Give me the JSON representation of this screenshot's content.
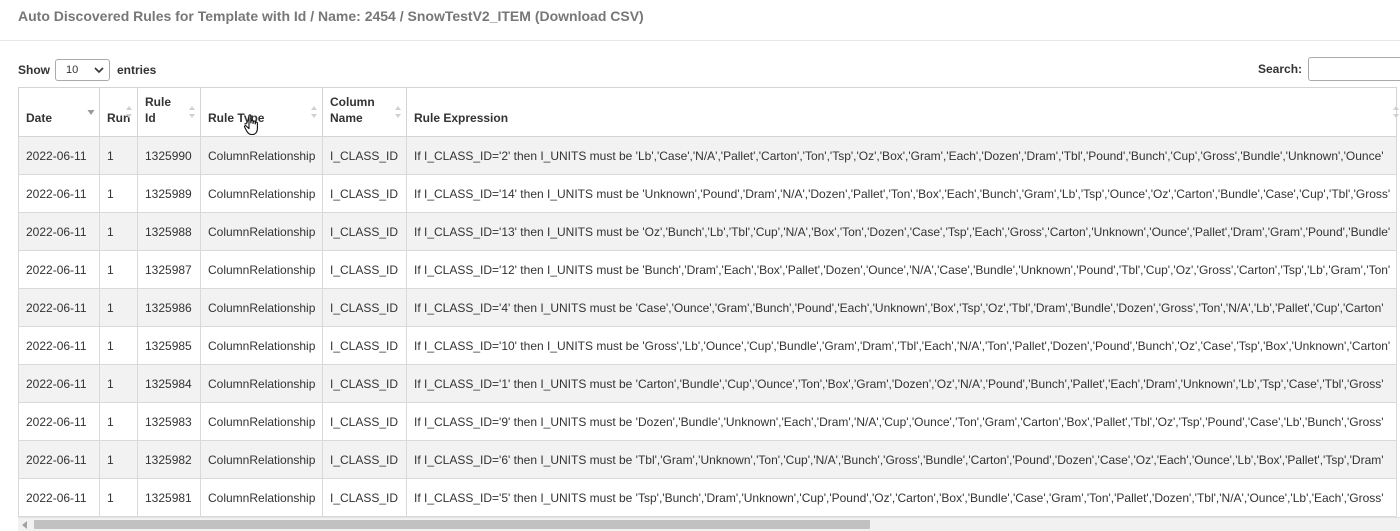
{
  "header": {
    "title": "Auto Discovered Rules for Template with Id / Name: 2454 / SnowTestV2_ITEM (Download CSV)"
  },
  "length_control": {
    "prefix": "Show",
    "selected": "10",
    "suffix": "entries"
  },
  "search": {
    "label": "Search:",
    "value": "",
    "placeholder": ""
  },
  "table": {
    "columns": [
      "Date",
      "Run",
      "Rule Id",
      "Rule Type",
      "Column Name",
      "Rule Expression"
    ],
    "sorted_column": "Date",
    "sort_direction": "descending",
    "rows": [
      [
        "2022-06-11",
        "1",
        "1325990",
        "ColumnRelationship",
        "I_CLASS_ID",
        "If I_CLASS_ID='2' then I_UNITS must be 'Lb','Case','N/A','Pallet','Carton','Ton','Tsp','Oz','Box','Gram','Each','Dozen','Dram','Tbl','Pound','Bunch','Cup','Gross','Bundle','Unknown','Ounce'"
      ],
      [
        "2022-06-11",
        "1",
        "1325989",
        "ColumnRelationship",
        "I_CLASS_ID",
        "If I_CLASS_ID='14' then I_UNITS must be 'Unknown','Pound','Dram','N/A','Dozen','Pallet','Ton','Box','Each','Bunch','Gram','Lb','Tsp','Ounce','Oz','Carton','Bundle','Case','Cup','Tbl','Gross'"
      ],
      [
        "2022-06-11",
        "1",
        "1325988",
        "ColumnRelationship",
        "I_CLASS_ID",
        "If I_CLASS_ID='13' then I_UNITS must be 'Oz','Bunch','Lb','Tbl','Cup','N/A','Box','Ton','Dozen','Case','Tsp','Each','Gross','Carton','Unknown','Ounce','Pallet','Dram','Gram','Pound','Bundle'"
      ],
      [
        "2022-06-11",
        "1",
        "1325987",
        "ColumnRelationship",
        "I_CLASS_ID",
        "If I_CLASS_ID='12' then I_UNITS must be 'Bunch','Dram','Each','Box','Pallet','Dozen','Ounce','N/A','Case','Bundle','Unknown','Pound','Tbl','Cup','Oz','Gross','Carton','Tsp','Lb','Gram','Ton'"
      ],
      [
        "2022-06-11",
        "1",
        "1325986",
        "ColumnRelationship",
        "I_CLASS_ID",
        "If I_CLASS_ID='4' then I_UNITS must be 'Case','Ounce','Gram','Bunch','Pound','Each','Unknown','Box','Tsp','Oz','Tbl','Dram','Bundle','Dozen','Gross','Ton','N/A','Lb','Pallet','Cup','Carton'"
      ],
      [
        "2022-06-11",
        "1",
        "1325985",
        "ColumnRelationship",
        "I_CLASS_ID",
        "If I_CLASS_ID='10' then I_UNITS must be 'Gross','Lb','Ounce','Cup','Bundle','Gram','Dram','Tbl','Each','N/A','Ton','Pallet','Dozen','Pound','Bunch','Oz','Case','Tsp','Box','Unknown','Carton'"
      ],
      [
        "2022-06-11",
        "1",
        "1325984",
        "ColumnRelationship",
        "I_CLASS_ID",
        "If I_CLASS_ID='1' then I_UNITS must be 'Carton','Bundle','Cup','Ounce','Ton','Box','Gram','Dozen','Oz','N/A','Pound','Bunch','Pallet','Each','Dram','Unknown','Lb','Tsp','Case','Tbl','Gross'"
      ],
      [
        "2022-06-11",
        "1",
        "1325983",
        "ColumnRelationship",
        "I_CLASS_ID",
        "If I_CLASS_ID='9' then I_UNITS must be 'Dozen','Bundle','Unknown','Each','Dram','N/A','Cup','Ounce','Ton','Gram','Carton','Box','Pallet','Tbl','Oz','Tsp','Pound','Case','Lb','Bunch','Gross'"
      ],
      [
        "2022-06-11",
        "1",
        "1325982",
        "ColumnRelationship",
        "I_CLASS_ID",
        "If I_CLASS_ID='6' then I_UNITS must be 'Tbl','Gram','Unknown','Ton','Cup','N/A','Bunch','Gross','Bundle','Carton','Pound','Dozen','Case','Oz','Each','Ounce','Lb','Box','Pallet','Tsp','Dram'"
      ],
      [
        "2022-06-11",
        "1",
        "1325981",
        "ColumnRelationship",
        "I_CLASS_ID",
        "If I_CLASS_ID='5' then I_UNITS must be 'Tsp','Bunch','Dram','Unknown','Cup','Pound','Oz','Carton','Box','Bundle','Case','Gram','Ton','Pallet','Dozen','Tbl','N/A','Ounce','Lb','Each','Gross'"
      ]
    ]
  },
  "scrollbar": {
    "horizontal_position": 0.0,
    "horizontal_visible_fraction": 0.61
  },
  "colors": {
    "title_text": "#777777",
    "row_odd": "#f2f2f2",
    "row_even": "#ffffff",
    "border": "#d4d4d4"
  },
  "icons": [
    "chevron-down-icon",
    "sort-desc-icon",
    "sort-both-icon",
    "scroll-left-arrow-icon",
    "hand-pointer-cursor-icon"
  ]
}
